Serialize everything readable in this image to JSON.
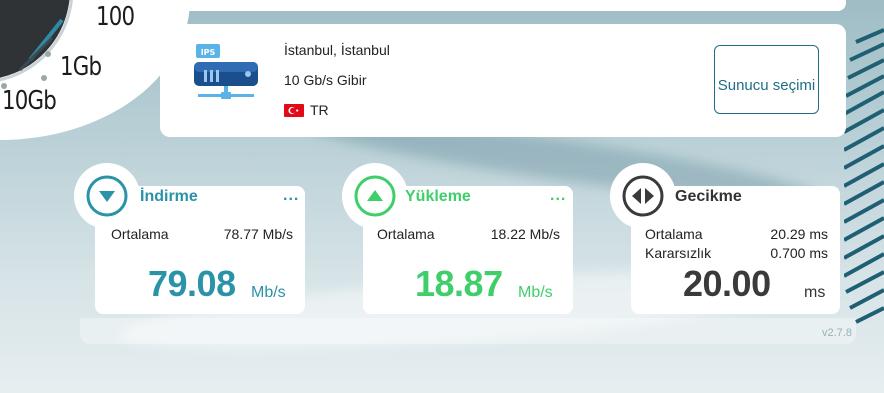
{
  "gauge": {
    "labels": [
      "100",
      "1Gb",
      "10Gb"
    ]
  },
  "server": {
    "city": "İstanbul, İstanbul",
    "provider": "10 Gb/s Gibir",
    "country_code": "TR",
    "icon_badge": "IPS",
    "icon": "server-icon",
    "select_button": "Sunucu seçimi"
  },
  "download": {
    "title": "İndirme",
    "dots": "...",
    "avg_label": "Ortalama",
    "avg_value": "78.77 Mb/s",
    "value": "79.08",
    "unit": "Mb/s",
    "color": "#2a93a8",
    "icon": "download-arrow-icon"
  },
  "upload": {
    "title": "Yükleme",
    "dots": "...",
    "avg_label": "Ortalama",
    "avg_value": "18.22 Mb/s",
    "value": "18.87",
    "unit": "Mb/s",
    "color": "#3fcf6a",
    "icon": "upload-arrow-icon"
  },
  "latency": {
    "title": "Gecikme",
    "avg_label": "Ortalama",
    "avg_value": "20.29 ms",
    "jitter_label": "Kararsızlık",
    "jitter_value": "0.700 ms",
    "value": "20.00",
    "unit": "ms",
    "color": "#3a3a3a",
    "icon": "ping-icon"
  },
  "version": "v2.7.8"
}
